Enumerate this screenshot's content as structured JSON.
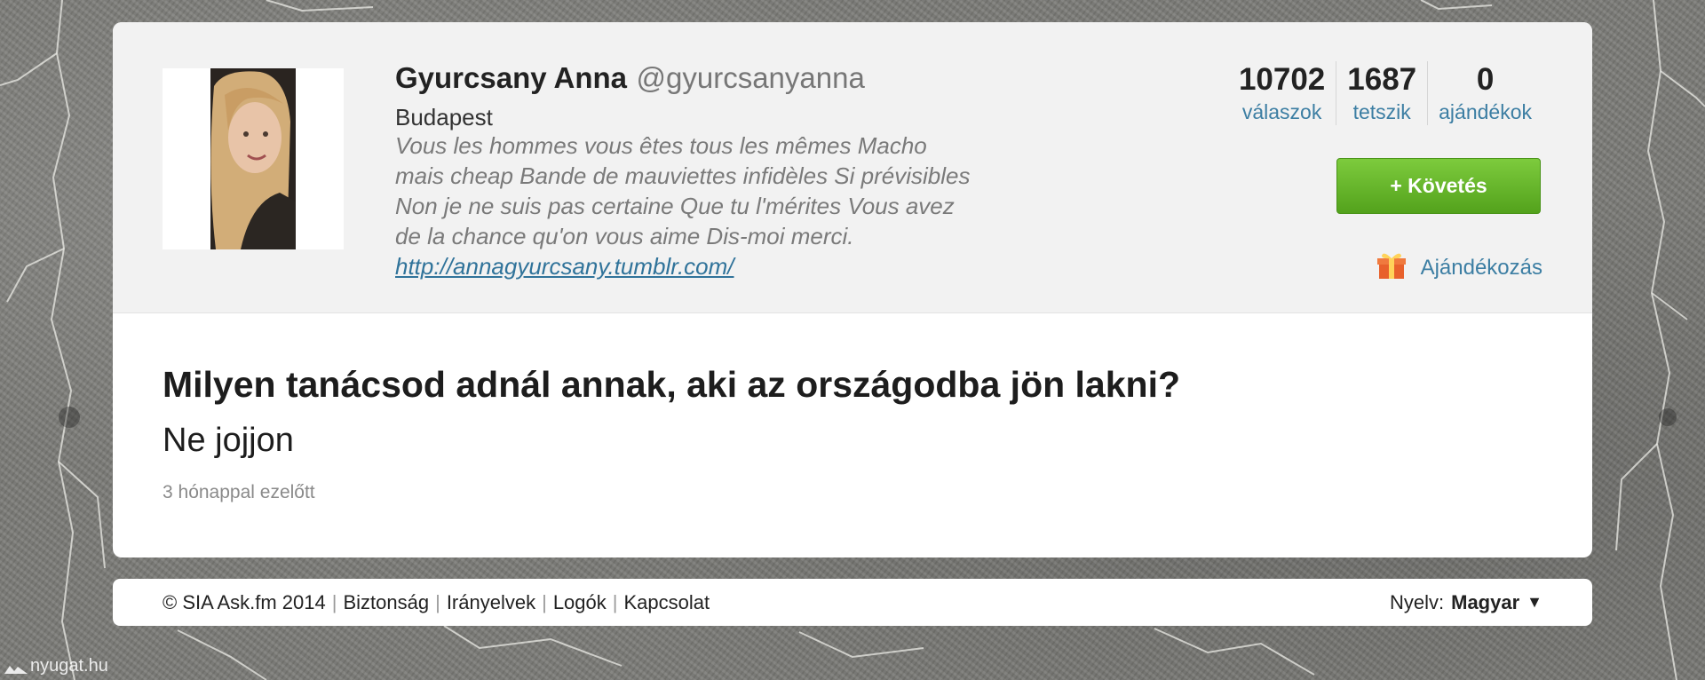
{
  "profile": {
    "display_name": "Gyurcsany Anna",
    "username": "@gyurcsanyanna",
    "location": "Budapest",
    "bio_lines": [
      "Vous les hommes vous êtes tous les mêmes Macho",
      "mais cheap Bande de mauviettes infidèles Si prévisibles",
      "Non je ne suis pas certaine Que tu l'mérites Vous avez",
      "de la chance qu'on vous aime Dis-moi merci."
    ],
    "link": "http://annagyurcsany.tumblr.com/",
    "stats": [
      {
        "value": "10702",
        "label": "válaszok"
      },
      {
        "value": "1687",
        "label": "tetszik"
      },
      {
        "value": "0",
        "label": "ajándékok"
      }
    ],
    "follow_label": "+ Követés",
    "gift_label": "Ajándékozás"
  },
  "post": {
    "question": "Milyen tanácsod adnál annak, aki az országodba jön lakni?",
    "answer": "Ne jojjon",
    "time_ago": "3 hónappal ezelőtt"
  },
  "footer": {
    "copyright": "© SIA Ask.fm 2014",
    "links": [
      "Biztonság",
      "Irányelvek",
      "Logók",
      "Kapcsolat"
    ],
    "separator": "|",
    "language_label": "Nyelv:",
    "language_value": "Magyar",
    "language_caret": "▼"
  },
  "watermark": {
    "text": "nyugat.hu"
  },
  "icons": {
    "gift": "gift-icon",
    "avatar": "profile-photo"
  },
  "colors": {
    "follow_button": "#5cae26",
    "link": "#3c7ea3",
    "header_bg": "#f2f2f2"
  }
}
